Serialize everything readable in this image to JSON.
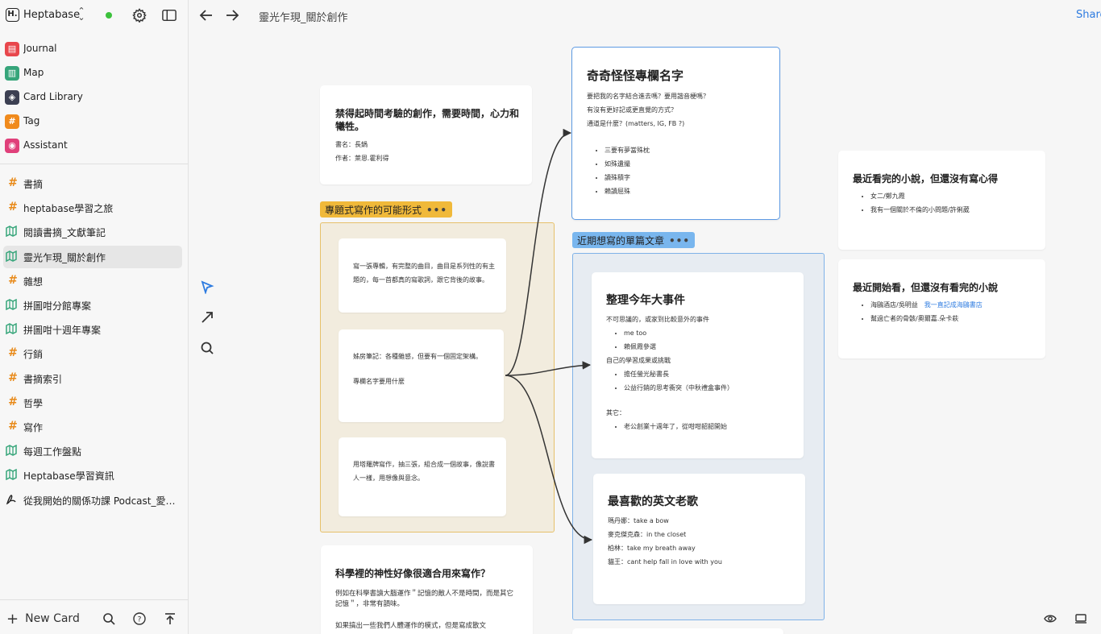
{
  "workspace": {
    "logo": "H.",
    "name": "Heptabase",
    "status_color": "#3cc13c"
  },
  "nav": [
    {
      "label": "Journal",
      "icon": "calendar-icon",
      "color": "#e8474c"
    },
    {
      "label": "Map",
      "icon": "map-icon",
      "color": "#36a57a"
    },
    {
      "label": "Card Library",
      "icon": "layers-icon",
      "color": "#3c3f52"
    },
    {
      "label": "Tag",
      "icon": "hash-icon",
      "color": "#f08a1c"
    },
    {
      "label": "Assistant",
      "icon": "assistant-icon",
      "color": "#e0407a"
    }
  ],
  "items": [
    {
      "label": "書摘",
      "type": "tag"
    },
    {
      "label": "heptabase學習之旅",
      "type": "tag"
    },
    {
      "label": "閱讀書摘_文獻筆記",
      "type": "map"
    },
    {
      "label": "靈光乍現_關於創作",
      "type": "map",
      "active": true
    },
    {
      "label": "雜想",
      "type": "tag"
    },
    {
      "label": "拼圖咁分館專案",
      "type": "map"
    },
    {
      "label": "拼圖咁十週年專案",
      "type": "map"
    },
    {
      "label": "行銷",
      "type": "tag"
    },
    {
      "label": "書摘索引",
      "type": "tag"
    },
    {
      "label": "哲學",
      "type": "tag"
    },
    {
      "label": "寫作",
      "type": "tag"
    },
    {
      "label": "每週工作盤點",
      "type": "map"
    },
    {
      "label": "Heptabase學習資訊",
      "type": "map"
    },
    {
      "label": "從我開始的關係功課 Podcast_愛的...",
      "type": "pdf"
    }
  ],
  "bottom": {
    "new_card": "New Card"
  },
  "topbar": {
    "title": "靈光乍現_關於創作",
    "share": "Share"
  },
  "cards": {
    "c1": {
      "title": "禁得起時間考驗的創作，需要時間，心力和犧牲。",
      "lines": [
        "書名：長鍋",
        "作者：萊恩.霍利得"
      ]
    },
    "c2": {
      "title": "奇奇怪怪專欄名字",
      "lines": [
        "要把我的名字結合進去嗎？要用諧音梗嗎？",
        "有沒有更好記或更直覺的方式？",
        "通道是什麼？(matters, IG, FB ?)"
      ],
      "bullets": [
        "三要有夢當殊枕",
        "如殊遺撮",
        "讀殊積字",
        "賴讀屈殊"
      ]
    },
    "c3": {
      "title": "最近看完的小說，但還沒有寫心得",
      "bullets": [
        "女二/鄭九霞",
        "我有一個關於不倫的小問題/許俐葳"
      ]
    },
    "c4": {
      "title": "最近開始看，但還沒有看完的小說",
      "bullets": [
        {
          "a": "海鷗酒店/吳明益",
          "b": "我一直記成海鷗書店"
        },
        "幫過亡者的骨骸/奧爾嘉.朵卡萩"
      ]
    },
    "c5": {
      "text": "寫一張專輯，有完整的曲目，曲目是系列性的有主題的，每一首都真的寫歌詞，跟它背後的故事。"
    },
    "c6": {
      "text": "姊房筆記：各種雜感，但要有一個固定架構。",
      "link": "專欄名字要用什麼"
    },
    "c7": {
      "text": "用塔羅牌寫作，抽三張，組合成一個故事，像說書人一樣，用想像與意念。"
    },
    "c8": {
      "title": "整理今年大事件",
      "lines": [
        "不可思議的，或家到比較意外的事件"
      ],
      "bullets1": [
        "me too",
        "賴佩霞參選"
      ],
      "line2": "自己的學習成果或挑戰",
      "bullets2": [
        "擔任螢光秘書長",
        "公益行銷的思考衝突（中秋禮盒事件）"
      ],
      "line3": "其它：",
      "bullets3": [
        "老公創業十週年了，從咁咁韶韶開始"
      ]
    },
    "c9": {
      "title": "最喜歡的英文老歌",
      "lines": [
        "瑪丹娜：take a bow",
        "麥克傑克森：in the closet",
        "柏林：take my breath away",
        "貓王：cant help fall in love with you"
      ]
    },
    "c10": {
      "title": "科學裡的神性好像很適合用來寫作？",
      "lines": [
        "例如在科學書讀大腦運作＂記憶的敵人不是時間，而是其它記憶＂，非常有韻味。",
        "如果搞出一些我們人體運作的模式，但是寫成散文"
      ]
    }
  },
  "sections": {
    "s1": {
      "label": "專題式寫作的可能形式",
      "color": "#f0b93a"
    },
    "s2": {
      "label": "近期想寫的單篇文章",
      "color": "#79b6ee"
    }
  }
}
